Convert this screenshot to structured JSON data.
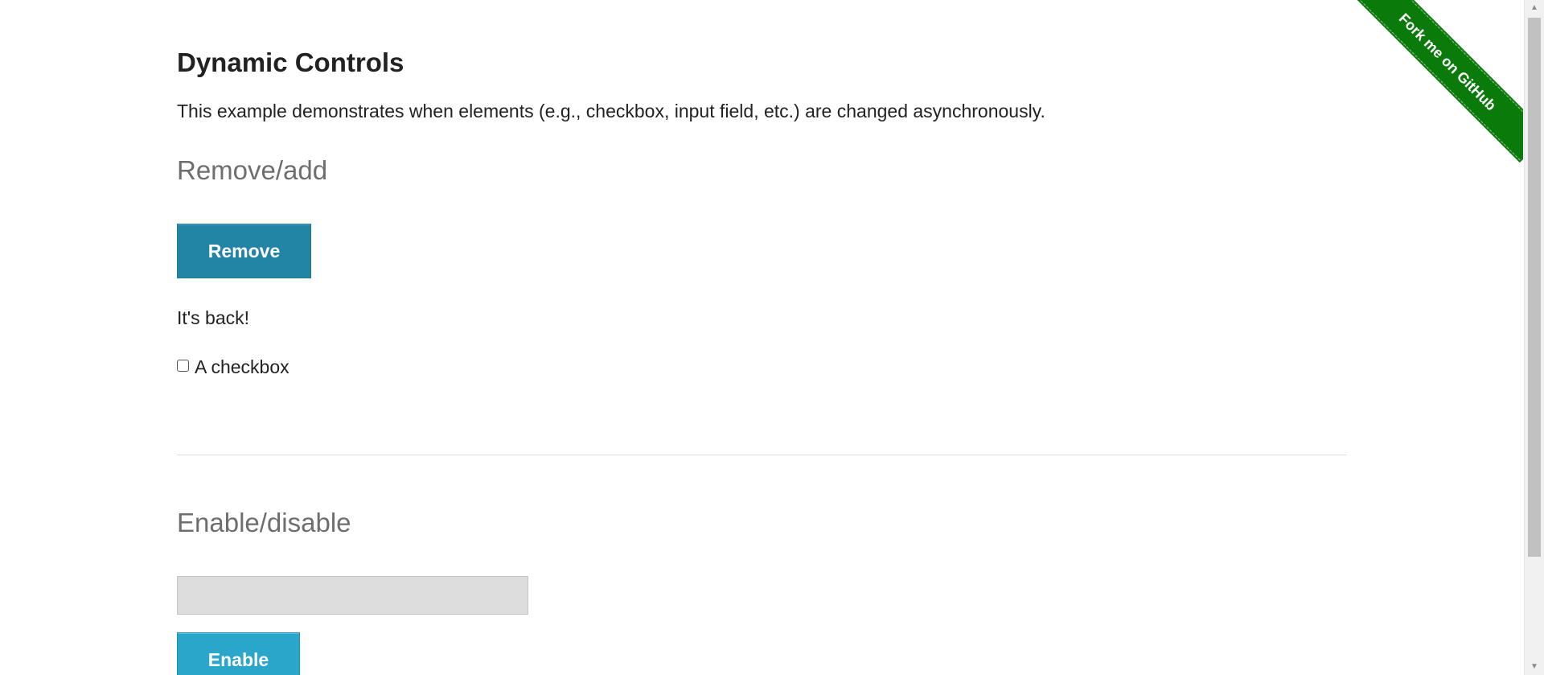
{
  "page": {
    "title": "Dynamic Controls",
    "description": "This example demonstrates when elements (e.g., checkbox, input field, etc.) are changed asynchronously."
  },
  "remove_add": {
    "heading": "Remove/add",
    "button_label": "Remove",
    "message": "It's back!",
    "checkbox_label": "A checkbox",
    "checkbox_checked": false
  },
  "enable_disable": {
    "heading": "Enable/disable",
    "input_value": "",
    "input_disabled": true,
    "button_label": "Enable"
  },
  "ribbon": {
    "label": "Fork me on GitHub",
    "color": "#0a7a0a"
  },
  "colors": {
    "remove_button": "#2285a6",
    "enable_button": "#2ba6cb",
    "section_heading": "#6e6e6e"
  },
  "scrollbar": {
    "up_icon": "triangle-up-icon",
    "down_icon": "triangle-down-icon"
  }
}
